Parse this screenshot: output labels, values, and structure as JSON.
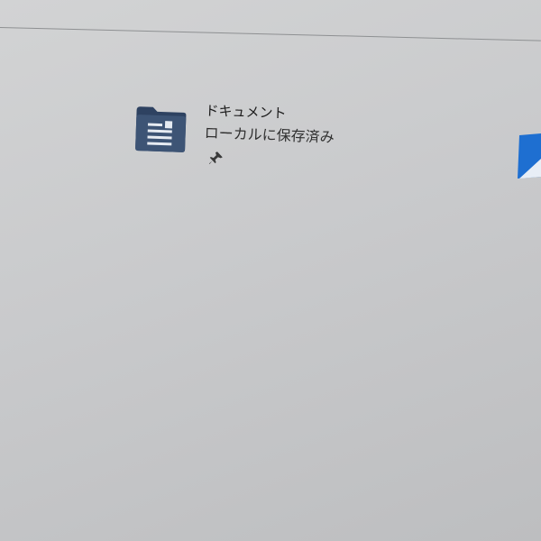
{
  "quick_access": {
    "items": [
      {
        "title": "ドキュメント",
        "subtitle": "ローカルに保存済み",
        "icon": "documents-folder-icon",
        "pinned": true
      }
    ]
  },
  "colors": {
    "folder_body": "#3d5475",
    "folder_tab": "#2e4261",
    "next_icon": "#1e6fd1"
  }
}
